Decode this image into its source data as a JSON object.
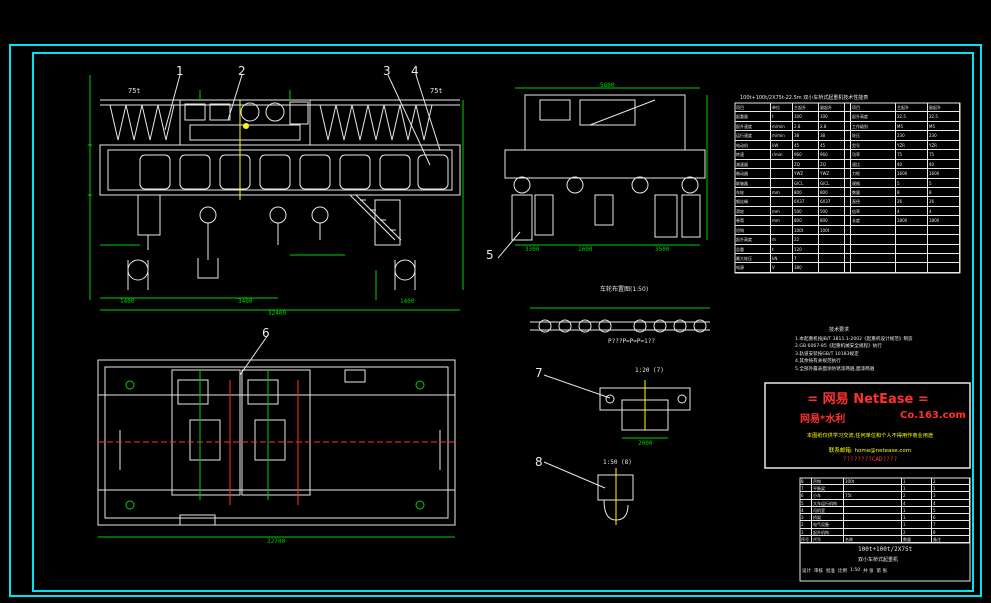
{
  "callouts": [
    "1",
    "2",
    "3",
    "4",
    "5",
    "6",
    "7",
    "8"
  ],
  "front_view": {
    "top_labels": [
      "75t",
      "L=t",
      "75t"
    ],
    "dims": [
      "32400",
      "1400",
      "3400",
      "1400",
      "3260",
      "2900",
      "3000"
    ]
  },
  "side_view": {
    "top_dim": "5800",
    "bottom_dims": [
      "3300",
      "1600",
      "3500"
    ],
    "label": "1300"
  },
  "wheel_layout": {
    "title": "车轮布置图(1:50)",
    "note": "P???P=P=P=1??",
    "labels": [
      "P1",
      "P2",
      "P1",
      "P2",
      "P1",
      "P2",
      "P1",
      "P2",
      "P1",
      "P2"
    ]
  },
  "plan_view": {
    "bottom_dim": "32700"
  },
  "detail_7": {
    "title": "1:20 (7)",
    "dim": "2000"
  },
  "detail_8": {
    "title": "1:50 (8)"
  },
  "spec_table": {
    "title": "100t+100t/2X75t-22.5m 双小车桥式起重机技术性能表",
    "columns": [
      "项目",
      "单位",
      "主起升",
      "副起升",
      "",
      "项目",
      "主起升",
      "副起升"
    ],
    "rows": [
      [
        "起重量",
        "t",
        "100",
        "100",
        "",
        "起升高度",
        "22.5",
        "22.5"
      ],
      [
        "起升速度",
        "m/min",
        "2.8",
        "2.8",
        "",
        "工作级别",
        "M5",
        "M5"
      ],
      [
        "运行速度",
        "m/min",
        "38",
        "38",
        "",
        "轮压",
        "230",
        "230"
      ],
      [
        "电动机",
        "kW",
        "45",
        "45",
        "",
        "型号",
        "YZR",
        "YZR"
      ],
      [
        "转速",
        "r/min",
        "960",
        "960",
        "",
        "功率",
        "75",
        "75"
      ],
      [
        "减速器",
        "",
        "ZQ",
        "ZQ",
        "",
        "速比",
        "40",
        "40"
      ],
      [
        "制动器",
        "",
        "YWZ",
        "YWZ",
        "",
        "力矩",
        "1600",
        "1600"
      ],
      [
        "联轴器",
        "",
        "GICL",
        "GICL",
        "",
        "规格",
        "5",
        "5"
      ],
      [
        "车轮",
        "mm",
        "800",
        "800",
        "",
        "数量",
        "8",
        "8"
      ],
      [
        "钢丝绳",
        "",
        "6X37",
        "6X37",
        "",
        "直径",
        "26",
        "26"
      ],
      [
        "滑轮",
        "mm",
        "500",
        "500",
        "",
        "倍率",
        "4",
        "4"
      ],
      [
        "卷筒",
        "mm",
        "800",
        "800",
        "",
        "长度",
        "1800",
        "1800"
      ],
      [
        "吊钩",
        "",
        "100t",
        "100t",
        "",
        "",
        "",
        ""
      ],
      [
        "起升高度",
        "m",
        "22",
        "",
        "",
        "",
        "",
        ""
      ],
      [
        "总重",
        "t",
        "120",
        "",
        "",
        "",
        "",
        ""
      ],
      [
        "最大轮压",
        "kN",
        "7",
        "",
        "",
        "",
        "",
        ""
      ],
      [
        "电源",
        "V",
        "380",
        "",
        "",
        "",
        "",
        ""
      ]
    ]
  },
  "notes": {
    "title": "技术要求",
    "lines": [
      "1.本起重机按JB/T 3811.1-2002《起重机设计规范》制造",
      "2.GB 6067-85《起重机械安全规程》执行",
      "3.轨道安装按GB/T 10183规定",
      "4.其余按有关规范执行",
      "5.全部外露表面涂防锈漆两遍,面漆两遍"
    ]
  },
  "watermark": {
    "title": "= 网易 NetEase =",
    "subtitle_left": "网易*水利",
    "subtitle_right": "Co.163.com",
    "line1": "本图纸仅供学习交流,任何单位和个人不得用作商业用途",
    "line2": "联系邮箱: home@netease.com",
    "line3": "????????CAD????"
  },
  "parts_table": {
    "rows": [
      [
        "8",
        "吊钩",
        "100t",
        "1",
        "2"
      ],
      [
        "7",
        "平衡梁",
        "",
        "1",
        "1"
      ],
      [
        "6",
        "小车",
        "75t",
        "2",
        "3"
      ],
      [
        "5",
        "大车运行机构",
        "",
        "4",
        "4"
      ],
      [
        "4",
        "司机室",
        "",
        "1",
        "5"
      ],
      [
        "3",
        "桥架",
        "",
        "1",
        "6"
      ],
      [
        "2",
        "电气设备",
        "",
        "1",
        "7"
      ],
      [
        "1",
        "起升机构",
        "",
        "2",
        "8"
      ]
    ],
    "header": [
      "序号",
      "代号",
      "名称",
      "数量",
      "备注"
    ]
  },
  "title_block": {
    "drawing_name": "100t+100t/2X75t",
    "subtitle": "双小车桥式起重机",
    "cells": [
      "设计",
      "审核",
      "批准",
      "比例",
      "1:50",
      "共 张",
      "第 张"
    ]
  },
  "colors": {
    "frame": "#00e5ee",
    "line": "#e8e8e8",
    "blue": "#4b6cff",
    "green": "#00d000",
    "yellow": "#ffff00",
    "red": "#ff3030",
    "magenta": "#ff40ff"
  }
}
